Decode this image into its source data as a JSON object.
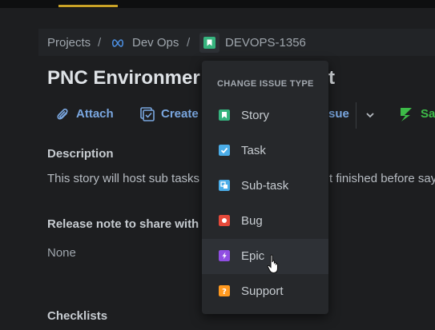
{
  "breadcrumb": {
    "projects": "Projects",
    "sep1": "/",
    "project": "Dev Ops",
    "sep2": "/",
    "issue_key": "DEVOPS-1356"
  },
  "issue": {
    "title_left": "PNC Environmer",
    "title_right": "t"
  },
  "toolbar": {
    "attach": "Attach",
    "create": "Create",
    "issue_frag": "sue",
    "save_frag": "Sa"
  },
  "description": {
    "heading": "Description",
    "text_left": "This story will host sub tasks",
    "text_right": "t finished before say"
  },
  "release_note": {
    "heading": "Release note to share with c",
    "value": "None"
  },
  "checklists": {
    "heading": "Checklists"
  },
  "change_menu": {
    "heading": "CHANGE ISSUE TYPE",
    "items": [
      {
        "label": "Story",
        "icon": "story-icon",
        "color": "#36b37e"
      },
      {
        "label": "Task",
        "icon": "task-icon",
        "color": "#4bade8"
      },
      {
        "label": "Sub-task",
        "icon": "subtask-icon",
        "color": "#4bade8"
      },
      {
        "label": "Bug",
        "icon": "bug-icon",
        "color": "#e5493a"
      },
      {
        "label": "Epic",
        "icon": "epic-icon",
        "color": "#904ee2"
      },
      {
        "label": "Support",
        "icon": "support-icon",
        "color": "#ff991f"
      }
    ],
    "hovered": "Epic"
  },
  "colors": {
    "background": "#1d1e20",
    "link": "#7aa7e0",
    "accent": "#c9a227"
  }
}
